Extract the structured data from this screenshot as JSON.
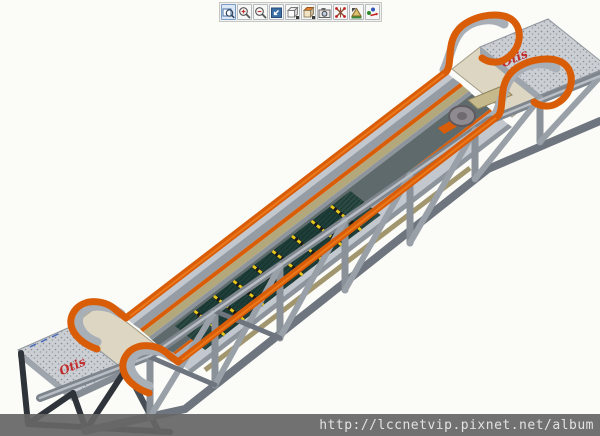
{
  "toolbar": {
    "icons": [
      {
        "name": "zoom-region"
      },
      {
        "name": "zoom-in"
      },
      {
        "name": "zoom-out"
      },
      {
        "name": "fit-view"
      },
      {
        "name": "view-orientation",
        "has_dropdown": true
      },
      {
        "name": "display-style",
        "has_dropdown": true
      },
      {
        "name": "snapshot"
      },
      {
        "name": "explode-view"
      },
      {
        "name": "measure"
      },
      {
        "name": "motion-path"
      }
    ]
  },
  "viewport": {
    "model": "escalator-3d-cad-model",
    "brand_logo": "Otis",
    "colors": {
      "handrail_orange": "#D95C07",
      "truss_gray": "#7E858D",
      "step_teal": "#1E3E39",
      "demarcation_yellow": "#E6C81C",
      "platform_gray": "#CBCFD4",
      "deck_tan": "#B3A77C",
      "logo_red": "#C22B2B",
      "background": "#FBFBF8"
    }
  },
  "watermark": {
    "url": "http://lccnetvip.pixnet.net/album",
    "bar_color": "#666666",
    "text_color": "#E2E2E2"
  }
}
